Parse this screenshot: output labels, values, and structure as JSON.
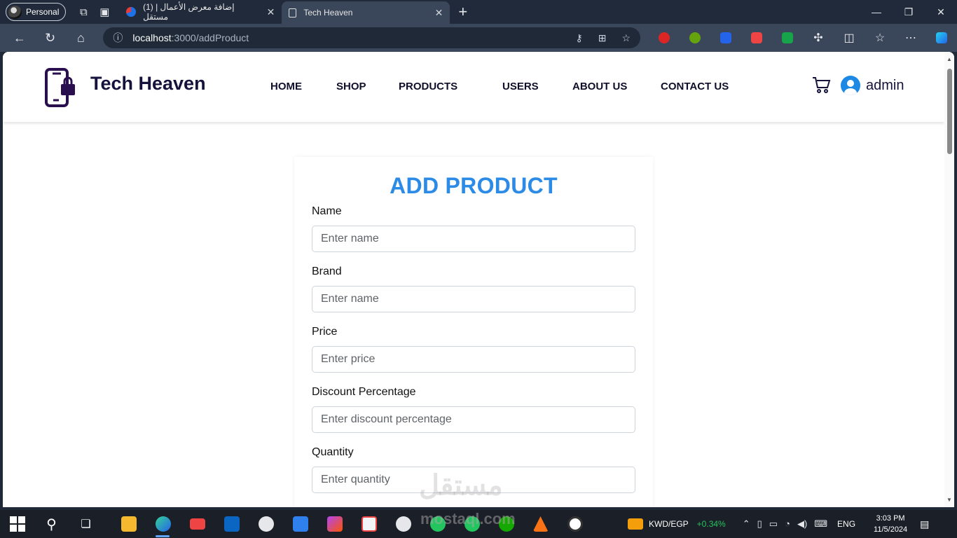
{
  "browser": {
    "profile_label": "Personal",
    "tabs": [
      {
        "title": "(1) إضافة معرض الأعمال | مستقل"
      },
      {
        "title": "Tech Heaven"
      }
    ],
    "url_host": "localhost",
    "url_path": ":3000/addProduct"
  },
  "site": {
    "brand": "Tech Heaven",
    "nav": [
      "HOME",
      "SHOP",
      "PRODUCTS",
      "USERS",
      "ABOUT US",
      "CONTACT US"
    ],
    "user_name": "admin"
  },
  "form": {
    "title": "ADD PRODUCT",
    "fields": [
      {
        "label": "Name",
        "placeholder": "Enter name"
      },
      {
        "label": "Brand",
        "placeholder": "Enter name"
      },
      {
        "label": "Price",
        "placeholder": "Enter price"
      },
      {
        "label": "Discount Percentage",
        "placeholder": "Enter discount percentage"
      },
      {
        "label": "Quantity",
        "placeholder": "Enter quantity"
      }
    ]
  },
  "watermark": {
    "arabic": "مستقل",
    "latin": "mostaql.com"
  },
  "taskbar": {
    "currency": "KWD/EGP",
    "change": "+0.34%",
    "language": "ENG",
    "time": "3:03 PM",
    "date": "11/5/2024"
  }
}
